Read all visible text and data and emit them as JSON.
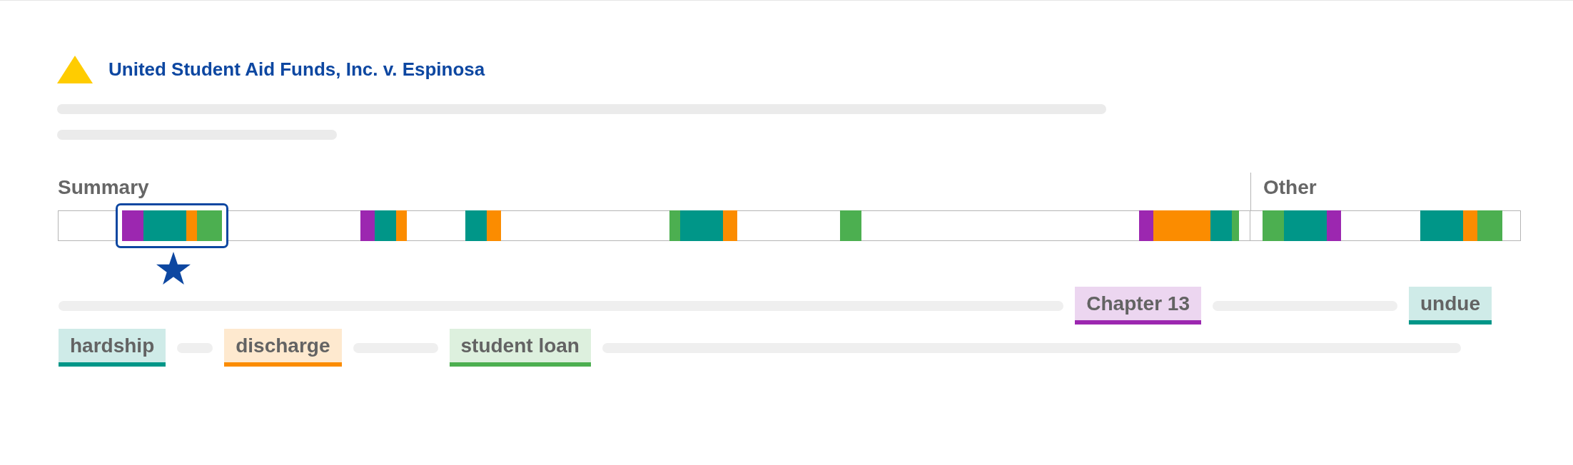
{
  "result": {
    "title": "United Student Aid Funds, Inc. v. Espinosa"
  },
  "timeline": {
    "sections": [
      {
        "label": "Summary"
      },
      {
        "label": "Other"
      }
    ]
  },
  "snippet": {
    "lines": [
      [
        {
          "kind": "placeholder"
        },
        {
          "kind": "tag",
          "label": "Chapter 13",
          "color": "#9c27b0"
        },
        {
          "kind": "placeholder"
        },
        {
          "kind": "tag",
          "label": "undue",
          "color": "#009688"
        }
      ],
      [
        {
          "kind": "tag",
          "label": "hardship",
          "color": "#009688"
        },
        {
          "kind": "placeholder"
        },
        {
          "kind": "tag",
          "label": "discharge",
          "color": "#fb8c00"
        },
        {
          "kind": "placeholder"
        },
        {
          "kind": "tag",
          "label": "student loan",
          "color": "#4caf50"
        },
        {
          "kind": "placeholder"
        }
      ]
    ]
  }
}
